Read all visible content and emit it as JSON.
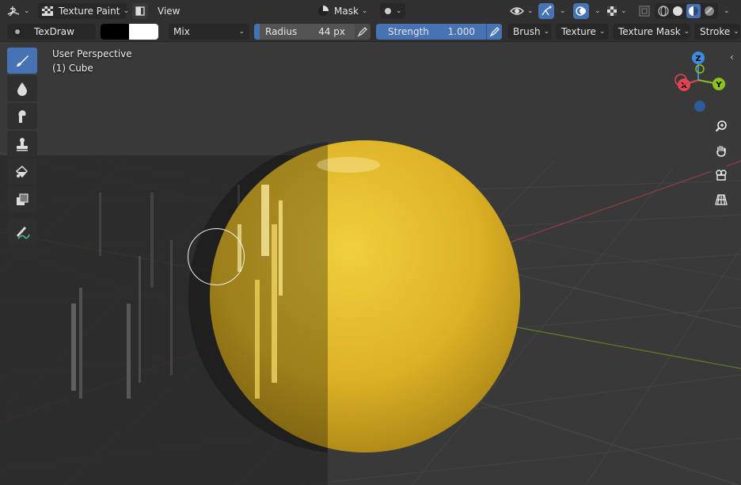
{
  "header": {
    "editor_type_icon": "3d-viewport-icon",
    "mode_label": "Texture Paint",
    "view_menu": "View",
    "mask_label": "Mask",
    "right_icons": [
      "visibility-icon",
      "gizmo-icon",
      "overlay-icon",
      "xray-icon",
      "shading-wire-icon",
      "shading-solid-icon",
      "shading-material-icon",
      "shading-rendered-icon"
    ]
  },
  "tool_settings": {
    "brush_name": "TexDraw",
    "color_swatch_1": "#000000",
    "color_swatch_2": "#ffffff",
    "blend_mode": "Mix",
    "radius_label": "Radius",
    "radius_value": "44 px",
    "strength_label": "Strength",
    "strength_value": "1.000",
    "strength_fill": 1.0,
    "menus": [
      "Brush",
      "Texture",
      "Texture Mask",
      "Stroke"
    ]
  },
  "viewport": {
    "perspective_label": "User Perspective",
    "object_label": "(1) Cube",
    "axis_labels": {
      "x": "X",
      "y": "Y",
      "z": "Z"
    }
  },
  "toolbar": {
    "tools": [
      "draw-brush-icon",
      "soften-icon",
      "smear-icon",
      "clone-icon",
      "fill-icon",
      "mask-icon",
      "annotate-icon"
    ]
  },
  "nav_buttons": [
    "zoom-icon",
    "pan-hand-icon",
    "camera-icon",
    "grid-perspective-icon"
  ],
  "colors": {
    "accent": "#4772b3",
    "header_bg": "#303030",
    "viewport_bg": "#393939",
    "sphere": "#e0b82a",
    "axis_x": "#e04556",
    "axis_y": "#8cc21f",
    "axis_z": "#3c8ce6"
  }
}
